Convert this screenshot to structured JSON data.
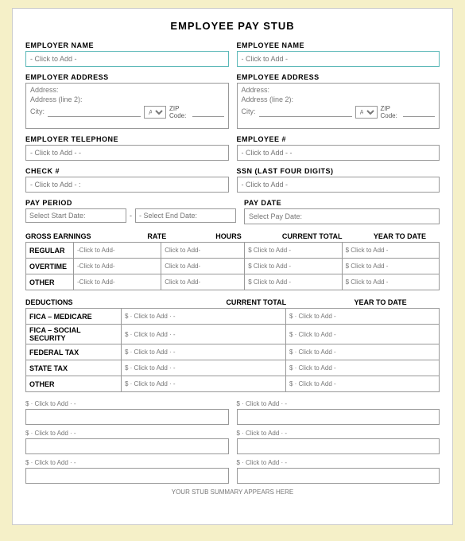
{
  "title": "EMPLOYEE PAY STUB",
  "employer": {
    "name_label": "EMPLOYER NAME",
    "name_placeholder": "- Click to Add -",
    "address_label": "EMPLOYER ADDRESS",
    "address_line1": "Address:",
    "address_line2": "Address (line 2):",
    "city_label": "City:",
    "state_label": "A",
    "zip_label": "ZIP Code:",
    "telephone_label": "EMPLOYER TELEPHONE",
    "telephone_placeholder": "- Click to Add - -"
  },
  "employee": {
    "name_label": "EMPLOYEE NAME",
    "name_placeholder": "- Click to Add -",
    "address_label": "EMPLOYEE ADDRESS",
    "address_line1": "Address:",
    "address_line2": "Address (line 2):",
    "city_label": "City:",
    "state_label": "A",
    "zip_label": "ZIP Code:",
    "number_label": "EMPLOYEE #",
    "number_placeholder": "- Click to Add - -"
  },
  "check": {
    "label": "CHECK #",
    "placeholder": "- Click to Add - :"
  },
  "ssn": {
    "label": "SSN (LAST FOUR DIGITS)",
    "placeholder": "- Click to Add -"
  },
  "pay_period": {
    "label": "PAY PERIOD",
    "start_placeholder": "Select Start Date:",
    "end_placeholder": "- Select End Date:",
    "dash": "-"
  },
  "pay_date": {
    "label": "PAY DATE",
    "placeholder": "Select Pay Date:"
  },
  "earnings": {
    "section_label": "GROSS EARNINGS",
    "rate_label": "RATE",
    "hours_label": "HOURS",
    "current_label": "CURRENT TOTAL",
    "ytd_label": "YEAR TO DATE",
    "rows": [
      {
        "label": "REGULAR",
        "rate": "-Click to Add-",
        "hours": "Click to Add-",
        "current": "$ Click to Add -",
        "ytd": "$ Click to Add -"
      },
      {
        "label": "OVERTIME",
        "rate": "-Click to Add-",
        "hours": "Click to Add-",
        "current": "$ Click to Add -",
        "ytd": "$ Click to Add -"
      },
      {
        "label": "OTHER",
        "rate": "-Click to Add-",
        "hours": "Click to Add-",
        "current": "$ Click to Add -",
        "ytd": "$ Click to Add -"
      }
    ]
  },
  "deductions": {
    "section_label": "DEDUCTIONS",
    "current_label": "CURRENT TOTAL",
    "ytd_label": "YEAR TO DATE",
    "rows": [
      {
        "label": "FICA – MEDICARE",
        "current": "$ · Click to Add · -",
        "ytd": "$ · Click to Add -"
      },
      {
        "label": "FICA – SOCIAL SECURITY",
        "current": "$ · Click to Add · -",
        "ytd": "$ · Click to Add -"
      },
      {
        "label": "FEDERAL TAX",
        "current": "$ · Click to Add · -",
        "ytd": "$ · Click to Add -"
      },
      {
        "label": "STATE TAX",
        "current": "$ · Click to Add · -",
        "ytd": "$ · Click to Add -"
      },
      {
        "label": "OTHER",
        "current": "$ · Click to Add · -",
        "ytd": "$ · Click to Add -"
      }
    ]
  },
  "summary": {
    "rows": [
      {
        "left_label": "$ · Click to Add · -",
        "right_label": "$ · Click to Add · -",
        "left_input": "",
        "right_input": ""
      },
      {
        "left_label": "$ · Click to Add · -",
        "right_label": "$ · Click to Add · -",
        "left_input": "",
        "right_input": ""
      },
      {
        "left_label": "$ · Click to Add · -",
        "right_label": "$ · Click to Add · -",
        "left_input": "",
        "right_input": ""
      }
    ],
    "footer_label": "YOUR STUB SUMMARY APPEARS HERE"
  }
}
